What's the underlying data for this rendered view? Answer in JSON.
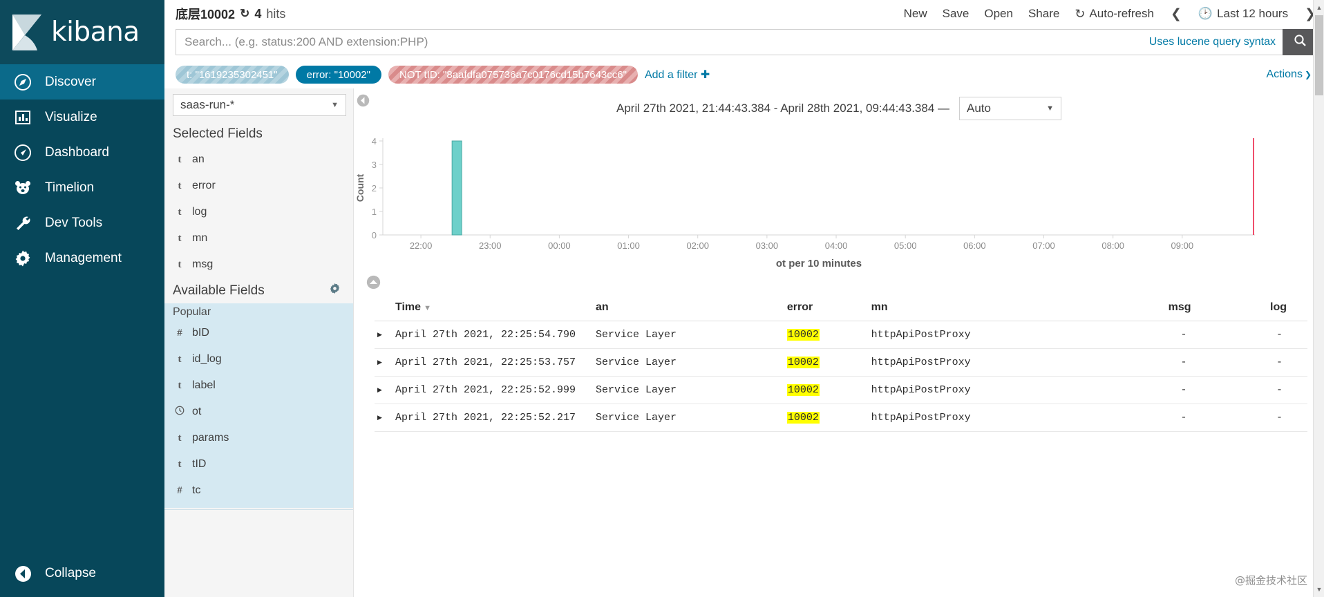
{
  "app": {
    "name": "kibana",
    "logo_icon": "kibana-logo-icon"
  },
  "nav": {
    "items": [
      {
        "label": "Discover",
        "icon": "compass-icon",
        "active": true
      },
      {
        "label": "Visualize",
        "icon": "bar-chart-icon",
        "active": false
      },
      {
        "label": "Dashboard",
        "icon": "dashboard-gauge-icon",
        "active": false
      },
      {
        "label": "Timelion",
        "icon": "bear-icon",
        "active": false
      },
      {
        "label": "Dev Tools",
        "icon": "wrench-icon",
        "active": false
      },
      {
        "label": "Management",
        "icon": "gear-icon",
        "active": false
      }
    ],
    "collapse": {
      "label": "Collapse",
      "icon": "chevron-left-circle-icon"
    }
  },
  "topbar": {
    "breadcrumb_title": "底层10002",
    "refresh_icon": "refresh-loop-icon",
    "hits_count": "4",
    "hits_label": "hits",
    "links": [
      "New",
      "Save",
      "Open",
      "Share"
    ],
    "auto_refresh": {
      "label": "Auto-refresh",
      "icon": "refresh-icon"
    },
    "prev_icon": "chevron-left-icon",
    "next_icon": "chevron-right-icon",
    "time_picker": {
      "label": "Last 12 hours",
      "icon": "clock-icon"
    }
  },
  "search": {
    "value": "",
    "placeholder": "Search... (e.g. status:200 AND extension:PHP)",
    "hint": "Uses lucene query syntax",
    "button_icon": "search-icon"
  },
  "filters": {
    "pills": [
      {
        "label": "t: \"1619235302451\"",
        "state": "disabled"
      },
      {
        "label": "error: \"10002\"",
        "state": "enabled"
      },
      {
        "label": "NOT tID: \"8aafdfa075736a7c0176cd15b7643cc6\"",
        "state": "negated"
      }
    ],
    "add_filter_label": "Add a filter",
    "add_filter_icon": "plus-icon",
    "actions_label": "Actions",
    "actions_icon": "chevron-right-icon"
  },
  "fieldbar": {
    "index_pattern": "saas-run-*",
    "index_caret_icon": "chevron-down-icon",
    "selected_fields_title": "Selected Fields",
    "selected_fields": [
      {
        "type": "t",
        "name": "an"
      },
      {
        "type": "t",
        "name": "error"
      },
      {
        "type": "t",
        "name": "log"
      },
      {
        "type": "t",
        "name": "mn"
      },
      {
        "type": "t",
        "name": "msg"
      }
    ],
    "available_fields_title": "Available Fields",
    "available_gear_icon": "gear-icon",
    "popular_label": "Popular",
    "popular_fields": [
      {
        "type": "#",
        "name": "bID"
      },
      {
        "type": "t",
        "name": "id_log"
      },
      {
        "type": "t",
        "name": "label"
      },
      {
        "type": "clock",
        "name": "ot"
      },
      {
        "type": "t",
        "name": "params"
      },
      {
        "type": "t",
        "name": "tID"
      },
      {
        "type": "#",
        "name": "tc"
      }
    ]
  },
  "chart_panel": {
    "collapse_icon": "chevron-left-circle-icon",
    "time_range": "April 27th 2021, 21:44:43.384 - April 28th 2021, 09:44:43.384 —",
    "interval": "Auto",
    "interval_caret_icon": "chevron-down-icon",
    "chart_collapse_icon": "chevron-up-circle-icon"
  },
  "chart_data": {
    "type": "bar",
    "title": "",
    "xlabel": "ot per 10 minutes",
    "ylabel": "Count",
    "ylim": [
      0,
      4
    ],
    "yticks": [
      0,
      1,
      2,
      3,
      4
    ],
    "xticks": [
      "22:00",
      "23:00",
      "00:00",
      "01:00",
      "02:00",
      "03:00",
      "04:00",
      "05:00",
      "06:00",
      "07:00",
      "08:00",
      "09:00"
    ],
    "x_start": "21:44:43.384",
    "x_end": "09:44:43.384",
    "bar_color": "#6ed0ca",
    "bar_stroke": "#4aa9a3",
    "end_marker_color": "#ef4e6b",
    "categories": [
      "22:30"
    ],
    "values": [
      4
    ],
    "grid": false,
    "legend": "none"
  },
  "table": {
    "columns": [
      {
        "key": "expand",
        "label": ""
      },
      {
        "key": "time",
        "label": "Time",
        "sorted": true,
        "sort_icon": "caret-down-icon"
      },
      {
        "key": "an",
        "label": "an"
      },
      {
        "key": "error",
        "label": "error"
      },
      {
        "key": "mn",
        "label": "mn"
      },
      {
        "key": "msg",
        "label": "msg"
      },
      {
        "key": "log",
        "label": "log"
      }
    ],
    "expand_icon": "caret-right-icon",
    "rows": [
      {
        "time": "April 27th 2021, 22:25:54.790",
        "an": "Service Layer",
        "error": "10002",
        "mn": "httpApiPostProxy",
        "msg": "-",
        "log": "-"
      },
      {
        "time": "April 27th 2021, 22:25:53.757",
        "an": "Service Layer",
        "error": "10002",
        "mn": "httpApiPostProxy",
        "msg": "-",
        "log": "-"
      },
      {
        "time": "April 27th 2021, 22:25:52.999",
        "an": "Service Layer",
        "error": "10002",
        "mn": "httpApiPostProxy",
        "msg": "-",
        "log": "-"
      },
      {
        "time": "April 27th 2021, 22:25:52.217",
        "an": "Service Layer",
        "error": "10002",
        "mn": "httpApiPostProxy",
        "msg": "-",
        "log": "-"
      }
    ]
  },
  "watermark": "@掘金技术社区",
  "colors": {
    "nav_bg": "#07475a",
    "nav_active": "#0b6a8a",
    "link": "#0079a5",
    "highlight": "#ffff00",
    "bar": "#6ed0ca",
    "popular_bg": "#d5e9f2"
  }
}
